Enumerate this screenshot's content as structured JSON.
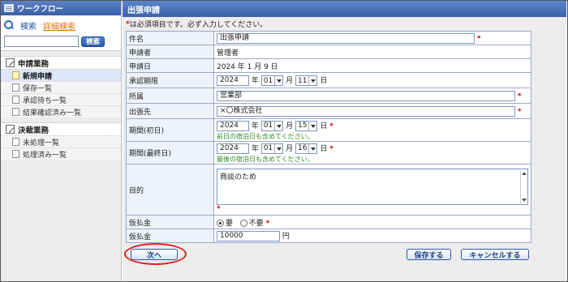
{
  "sidebar": {
    "title": "ワークフロー",
    "search_link": "検索",
    "advanced_link": "詳細検索",
    "search_button": "検索",
    "sections": [
      {
        "label": "申請業務",
        "items": [
          "新規申請",
          "保存一覧",
          "承認待ち一覧",
          "結果確認済み一覧"
        ]
      },
      {
        "label": "決裁業務",
        "items": [
          "未処理一覧",
          "処理済み一覧"
        ]
      }
    ]
  },
  "main": {
    "title": "出張申請",
    "required_note": "は必須項目です。必ず入力してください。",
    "required_mark": "*"
  },
  "form": {
    "subject": {
      "label": "件名",
      "value": "出張申請"
    },
    "applicant": {
      "label": "申請者",
      "value": "管理者"
    },
    "apply_date": {
      "label": "申請日",
      "value": "2024 年 1 月 9 日"
    },
    "approval_deadline": {
      "label": "承認期限",
      "year": "2024",
      "year_unit": "年",
      "month": "01",
      "month_unit": "月",
      "day": "11",
      "day_unit": "日"
    },
    "department": {
      "label": "所属",
      "value": "営業部"
    },
    "destination": {
      "label": "出張先",
      "value": "×〇株式会社"
    },
    "period_start": {
      "label": "期間(初日)",
      "year": "2024",
      "month": "01",
      "day": "15",
      "hint": "前日の宿泊日も含めてください。"
    },
    "period_end": {
      "label": "期間(最終日)",
      "year": "2024",
      "month": "01",
      "day": "16",
      "hint": "最後の宿泊日も含めてください。"
    },
    "purpose": {
      "label": "目的",
      "value": "商談のため"
    },
    "advance_payment": {
      "label": "仮払金",
      "option_yes": "要",
      "option_no": "不要",
      "selected": "要"
    },
    "advance_amount": {
      "label": "仮払金",
      "value": "10000",
      "unit": "円"
    }
  },
  "buttons": {
    "next": "次へ",
    "save": "保存する",
    "cancel": "キャンセルする"
  },
  "colors": {
    "header_blue": "#3c62aa",
    "required_red": "#d40000",
    "hint_green": "#2b8a1f",
    "highlight_red": "#e12020"
  }
}
